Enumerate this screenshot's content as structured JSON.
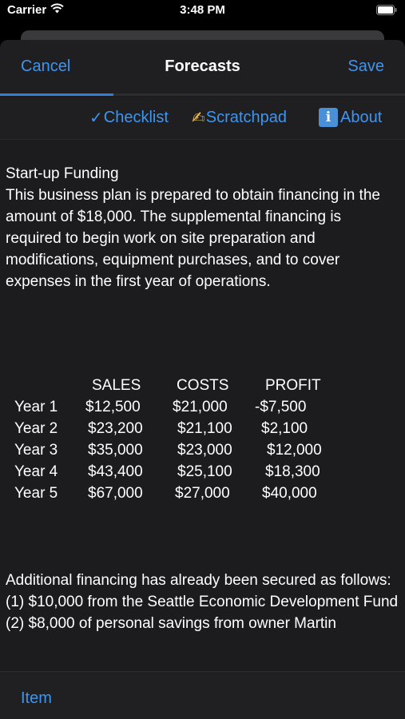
{
  "status_bar": {
    "carrier": "Carrier",
    "time": "3:48 PM"
  },
  "nav": {
    "cancel_label": "Cancel",
    "title": "Forecasts",
    "save_label": "Save",
    "progress": 0.28
  },
  "toolbar": {
    "checklist_icon": "✓",
    "checklist_label": "Checklist",
    "scratchpad_icon": "✍",
    "scratchpad_label": "Scratchpad",
    "about_icon": "i",
    "about_label": "About"
  },
  "content": {
    "heading": "Start-up Funding",
    "intro": "This business plan is prepared to obtain financing in the amount of $18,000. The supplemental financing is required to begin work on site preparation and modifications, equipment purchases, and to cover expenses in the first year of operations.",
    "table": {
      "headers": [
        "SALES",
        "COSTS",
        "PROFIT"
      ],
      "rows": [
        {
          "label": "Year 1",
          "sales": "$12,500",
          "costs": "$21,000",
          "profit": "-$7,500"
        },
        {
          "label": "Year 2",
          "sales": "$23,200",
          "costs": "$21,100",
          "profit": "$2,100"
        },
        {
          "label": "Year 3",
          "sales": "$35,000",
          "costs": "$23,000",
          "profit": "$12,000"
        },
        {
          "label": "Year 4",
          "sales": "$43,400",
          "costs": "$25,100",
          "profit": "$18,300"
        },
        {
          "label": "Year 5",
          "sales": "$67,000",
          "costs": "$27,000",
          "profit": "$40,000"
        }
      ]
    },
    "additional": [
      "Additional financing has already been secured as follows:",
      "(1) $10,000 from the Seattle Economic Development Fund",
      "(2) $8,000 of personal savings from owner Martin"
    ]
  },
  "bottom": {
    "item_label": "Item"
  },
  "colors": {
    "accent": "#3e95f0",
    "sheet_bg": "#1c1c1e",
    "bar_bg": "#1f1f21"
  }
}
